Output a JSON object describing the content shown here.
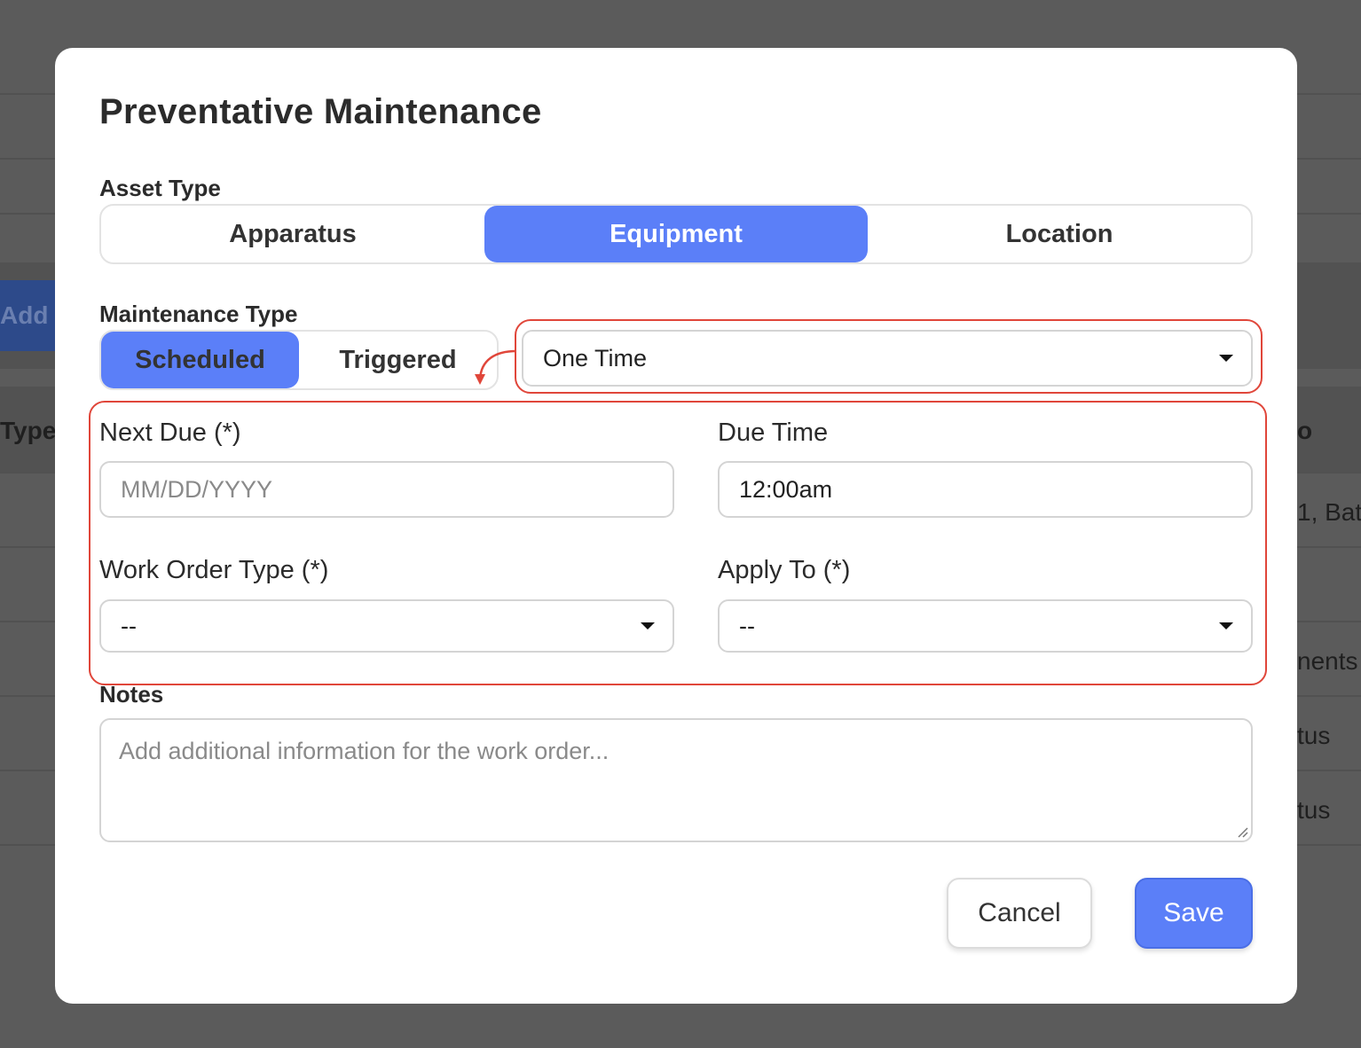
{
  "background": {
    "add_button_label": "Add M",
    "column_fragments": [
      "Type",
      "o",
      "1, Bat",
      "nents",
      "tus",
      "tus"
    ]
  },
  "modal": {
    "title": "Preventative Maintenance",
    "asset_type": {
      "label": "Asset Type",
      "options": [
        "Apparatus",
        "Equipment",
        "Location"
      ],
      "selected": "Equipment"
    },
    "maintenance_type": {
      "label": "Maintenance Type",
      "options": [
        "Scheduled",
        "Triggered"
      ],
      "selected": "Scheduled",
      "frequency_select": "One Time"
    },
    "next_due": {
      "label": "Next Due (*)",
      "placeholder": "MM/DD/YYYY",
      "value": ""
    },
    "due_time": {
      "label": "Due Time",
      "value": "12:00am"
    },
    "work_order_type": {
      "label": "Work Order Type (*)",
      "value": "--"
    },
    "apply_to": {
      "label": "Apply To (*)",
      "value": "--"
    },
    "notes": {
      "label": "Notes",
      "placeholder": "Add additional information for the work order..."
    },
    "buttons": {
      "cancel": "Cancel",
      "save": "Save"
    }
  },
  "colors": {
    "accent": "#5b7ff8",
    "annotation": "#e0463a",
    "overlay": "#5b5b5b"
  }
}
